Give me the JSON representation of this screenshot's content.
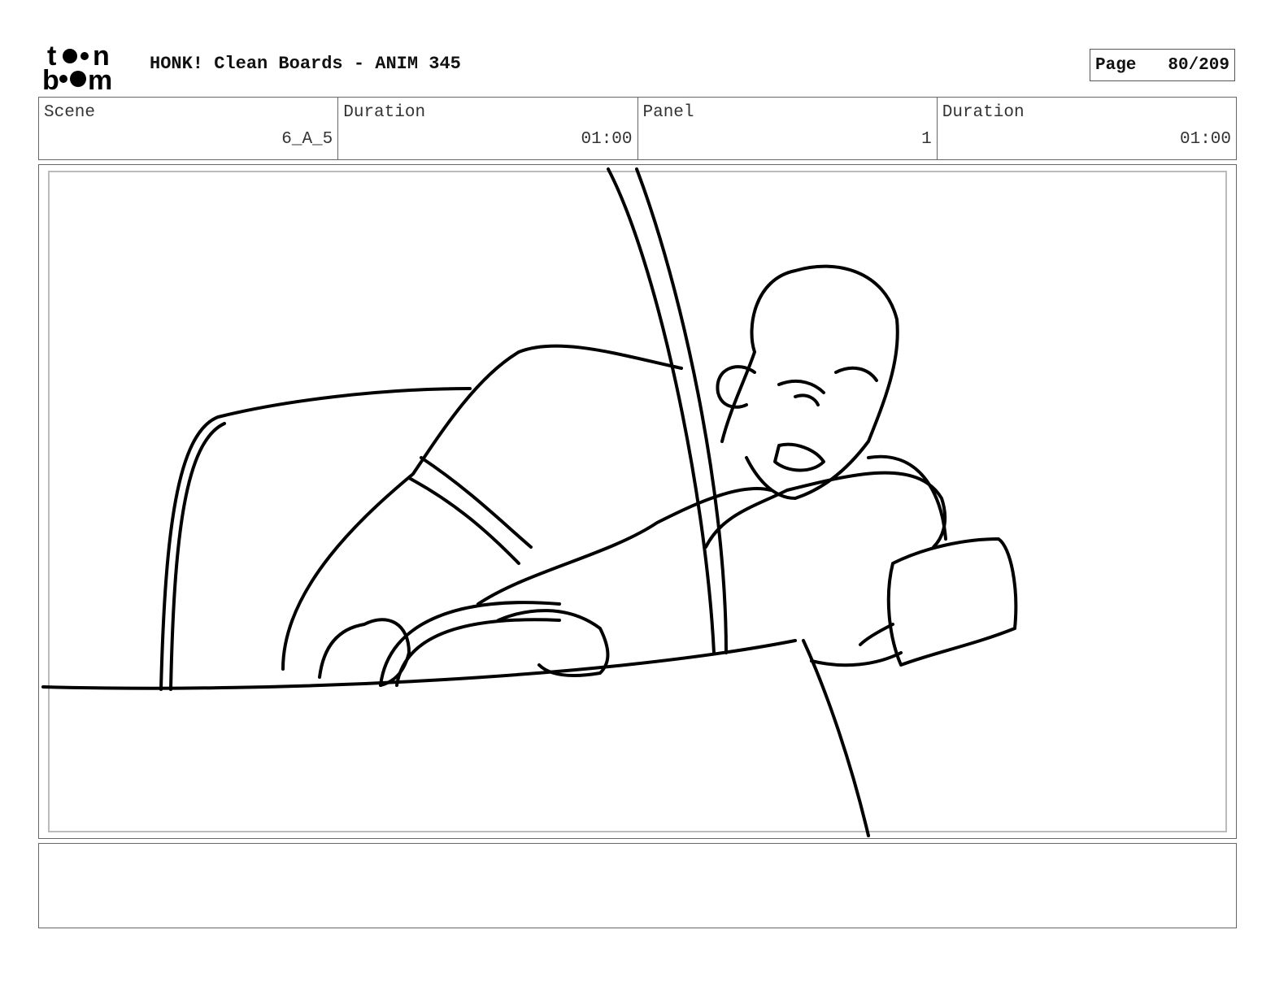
{
  "logo": {
    "text": "toon boom"
  },
  "header": {
    "title": "HONK! Clean Boards - ANIM 345",
    "page_label": "Page",
    "page_value": "80/209"
  },
  "fields": [
    {
      "label": "Scene",
      "value": "6_A_5"
    },
    {
      "label": "Duration",
      "value": "01:00"
    },
    {
      "label": "Panel",
      "value": "1"
    },
    {
      "label": "Duration",
      "value": "01:00"
    }
  ],
  "notes": {
    "text": ""
  }
}
